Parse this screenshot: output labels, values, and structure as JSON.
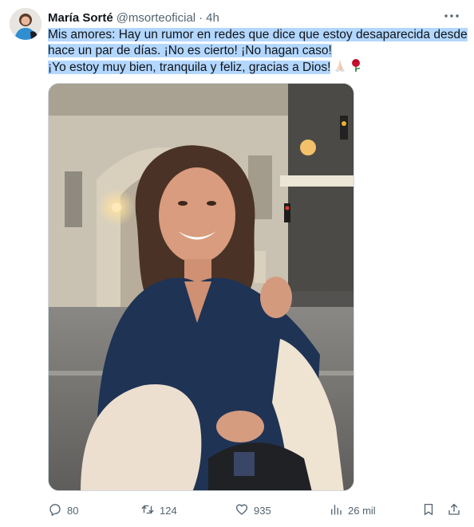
{
  "author": {
    "display_name": "María Sorté",
    "handle": "@msorteoficial",
    "separator": "·",
    "time": "4h"
  },
  "tweet": {
    "lines": [
      "Mis amores: Hay un rumor en redes que dice que estoy desaparecida desde",
      "hace un par de días. ¡No es cierto! ¡No hagan caso!",
      "¡Yo estoy muy bien, tranquila y feliz, gracias a Dios!"
    ],
    "emojis": [
      "praying-hands",
      "rose"
    ]
  },
  "photo": {
    "subject": "woman-smiling-street-night"
  },
  "actions": {
    "replies": "80",
    "reposts": "124",
    "likes": "935",
    "views": "26 mil"
  },
  "icons": {
    "more": "more-icon",
    "reply": "reply-icon",
    "repost": "repost-icon",
    "like": "heart-icon",
    "views": "views-icon",
    "bookmark": "bookmark-icon",
    "share": "share-icon"
  },
  "colors": {
    "text": "#0f1419",
    "secondary": "#536471",
    "highlight": "#b3d7ff",
    "border": "#cfd9de"
  }
}
